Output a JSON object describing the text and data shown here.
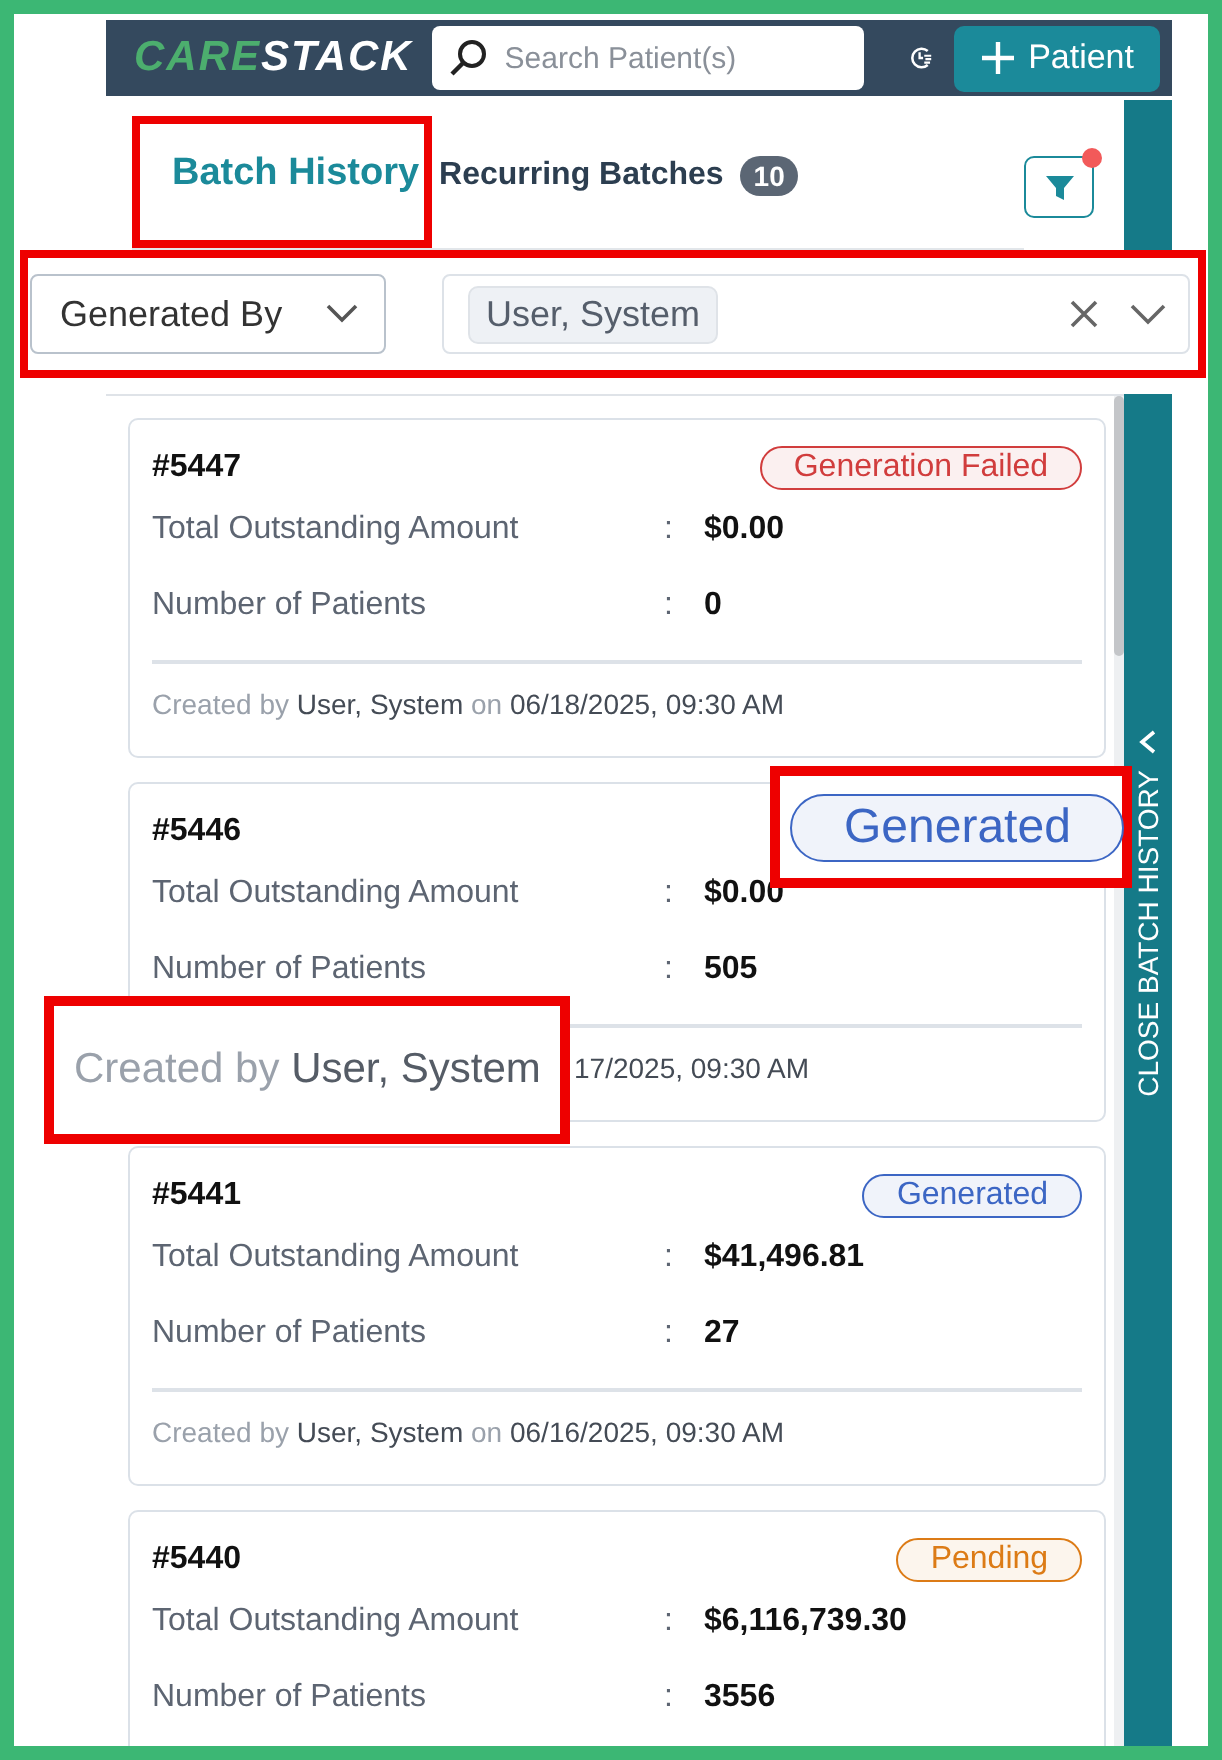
{
  "header": {
    "logo_parts": [
      "CARE",
      "STACK"
    ],
    "search": {
      "placeholder": "Search Patient(s)"
    },
    "add_button": "Patient"
  },
  "tabs": [
    {
      "label": "Batch History",
      "selected": true,
      "highlighted": true
    },
    {
      "label": "Recurring Batches",
      "selected": false,
      "highlighted": false,
      "count": "10"
    }
  ],
  "filter_button": {
    "has_indicator": true
  },
  "filters": {
    "highlighted": true,
    "field": "Generated By",
    "chips": [
      "User, System"
    ]
  },
  "batches": [
    {
      "id": "#5447",
      "status": {
        "text": "Generation Failed",
        "color": "#d13d3d"
      },
      "rows": [
        {
          "label": "Total Outstanding Amount",
          "separator": ":",
          "value": "$0.00"
        },
        {
          "label": "Number of Patients",
          "separator": ":",
          "value": "0"
        }
      ],
      "footer": {
        "by_label": "Created by",
        "user": "User, System",
        "on_label": "on",
        "date": "06/18/2025, 09:30 AM"
      }
    },
    {
      "id": "#5446",
      "rows": [
        {
          "label": "Total Outstanding Amount",
          "separator": ":",
          "value": "$0.00"
        },
        {
          "label": "Number of Patients",
          "separator": ":",
          "value": "505"
        }
      ],
      "footer": {
        "date": "17/2025, 09:30 AM"
      }
    },
    {
      "id": "#5441",
      "status": {
        "text": "Generated",
        "color": "#3c66c4"
      },
      "rows": [
        {
          "label": "Total Outstanding Amount",
          "separator": ":",
          "value": "$41,496.81"
        },
        {
          "label": "Number of Patients",
          "separator": ":",
          "value": "27"
        }
      ],
      "footer": {
        "by_label": "Created by",
        "user": "User, System",
        "on_label": "on",
        "date": "06/16/2025, 09:30 AM"
      }
    },
    {
      "id": "#5440",
      "status": {
        "text": "Pending",
        "color": "#dc7b16"
      },
      "rows": [
        {
          "label": "Total Outstanding Amount",
          "separator": ":",
          "value": "$6,116,739.30"
        },
        {
          "label": "Number of Patients",
          "separator": ":",
          "value": "3556"
        }
      ]
    }
  ],
  "side_panel": {
    "label": "CLOSE BATCH HISTORY"
  },
  "callouts": [
    {
      "kind": "status",
      "text": "Generated",
      "color": "#3c66c4"
    },
    {
      "kind": "created_by",
      "by_label": "Created by",
      "user": "User, System"
    }
  ]
}
